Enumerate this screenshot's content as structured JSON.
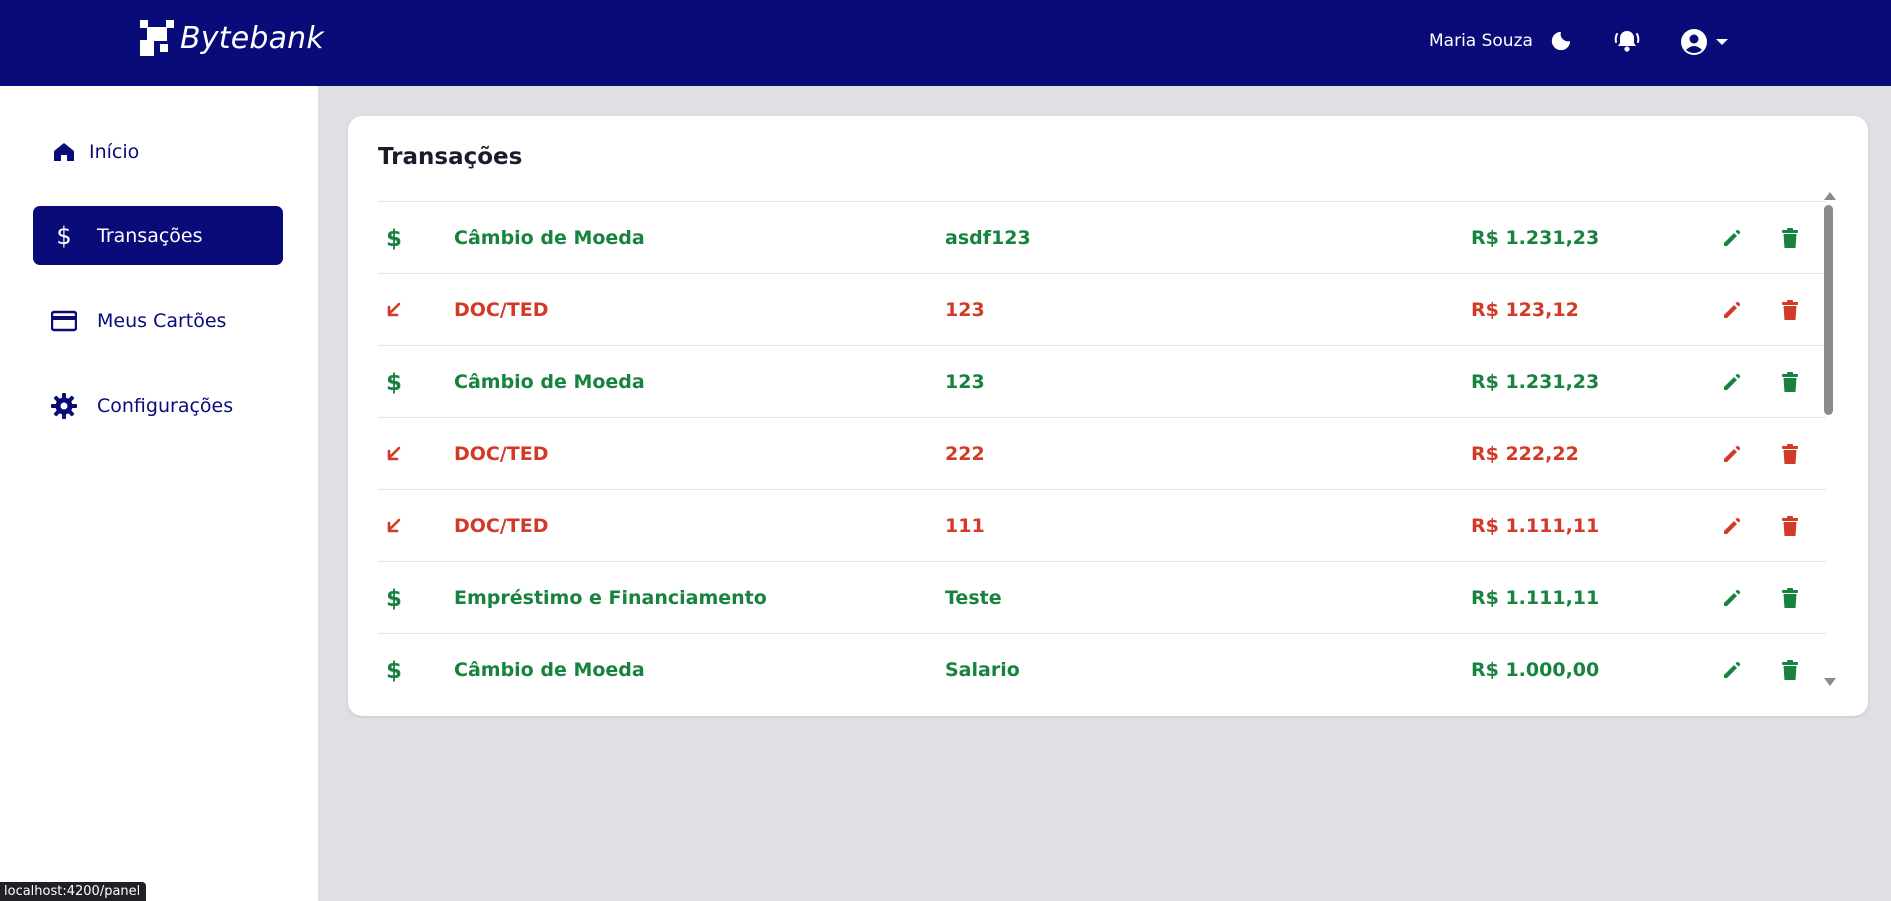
{
  "app": {
    "brand": "Bytebank",
    "user_name": "Maria Souza",
    "status_url": "localhost:4200/panel"
  },
  "colors": {
    "primary": "#090b78",
    "income": "#18823f",
    "expense": "#d23a28",
    "background": "#dfe0e5"
  },
  "sidebar": {
    "items": [
      {
        "label": "Início",
        "icon": "home-icon",
        "active": false
      },
      {
        "label": "Transações",
        "icon": "dollar-icon",
        "active": true
      },
      {
        "label": "Meus Cartões",
        "icon": "credit-card-icon",
        "active": false
      },
      {
        "label": "Configurações",
        "icon": "gear-icon",
        "active": false
      }
    ]
  },
  "transactions": {
    "title": "Transações",
    "rows": [
      {
        "kind": "income",
        "icon": "dollar-icon",
        "type": "Câmbio de Moeda",
        "description": "asdf123",
        "value": "R$ 1.231,23"
      },
      {
        "kind": "expense",
        "icon": "arrow-down-left-icon",
        "type": "DOC/TED",
        "description": "123",
        "value": "R$ 123,12"
      },
      {
        "kind": "income",
        "icon": "dollar-icon",
        "type": "Câmbio de Moeda",
        "description": "123",
        "value": "R$ 1.231,23"
      },
      {
        "kind": "expense",
        "icon": "arrow-down-left-icon",
        "type": "DOC/TED",
        "description": "222",
        "value": "R$ 222,22"
      },
      {
        "kind": "expense",
        "icon": "arrow-down-left-icon",
        "type": "DOC/TED",
        "description": "111",
        "value": "R$ 1.111,11"
      },
      {
        "kind": "income",
        "icon": "dollar-icon",
        "type": "Empréstimo e Financiamento",
        "description": "Teste",
        "value": "R$ 1.111,11"
      },
      {
        "kind": "income",
        "icon": "dollar-icon",
        "type": "Câmbio de Moeda",
        "description": "Salario",
        "value": "R$ 1.000,00"
      }
    ]
  }
}
